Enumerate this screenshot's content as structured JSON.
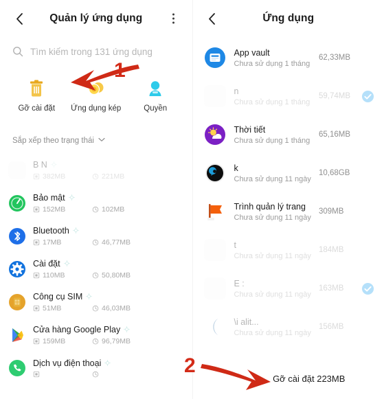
{
  "left_screen": {
    "header": {
      "back_icon": "chevron-left-icon",
      "title": "Quản lý ứng dụng",
      "overflow_icon": "kebab-menu-icon"
    },
    "search": {
      "icon": "search-icon",
      "placeholder": "Tìm kiếm trong 131 ứng dụng",
      "value": ""
    },
    "quick_actions": [
      {
        "label": "Gỡ cài đặt",
        "icon": "trash-icon",
        "color": "#F0B429"
      },
      {
        "label": "Ứng dụng kép",
        "icon": "coins-icon",
        "color": "#FFC83D"
      },
      {
        "label": "Quyền",
        "icon": "person-icon",
        "color": "#22BDE0"
      }
    ],
    "sort": {
      "label": "Sắp xếp theo trạng thái",
      "caret_icon": "chevron-down-icon"
    },
    "apps": [
      {
        "name": "B        N",
        "app_size": "382MB",
        "data_size": "221MB",
        "icon": "blank-icon",
        "icon_color": "#ffffff",
        "faded": true
      },
      {
        "name": "Bảo mật",
        "app_size": "152MB",
        "data_size": "102MB",
        "icon": "shield-security-icon",
        "icon_color": "#22C55E",
        "faded": false
      },
      {
        "name": "Bluetooth",
        "app_size": "17MB",
        "data_size": "46,77MB",
        "icon": "bluetooth-icon",
        "icon_color": "#1E6FE8",
        "faded": false
      },
      {
        "name": "Cài đặt",
        "app_size": "110MB",
        "data_size": "50,80MB",
        "icon": "gear-settings-icon",
        "icon_color": "#1273DE",
        "faded": false
      },
      {
        "name": "Công cụ SIM",
        "app_size": "51MB",
        "data_size": "46,03MB",
        "icon": "sim-card-icon",
        "icon_color": "#E5A32B",
        "faded": false
      },
      {
        "name": "Cửa hàng Google Play",
        "app_size": "159MB",
        "data_size": "96,79MB",
        "icon": "google-play-icon",
        "icon_color": "#34A853",
        "faded": false
      },
      {
        "name": "Dịch vụ điện thoại",
        "app_size": "",
        "data_size": "",
        "icon": "phone-icon",
        "icon_color": "#2ECC71",
        "faded": false
      }
    ],
    "storage_icon": "storage-icon",
    "clock_icon": "clock-icon"
  },
  "right_screen": {
    "header": {
      "back_icon": "chevron-left-icon",
      "title": "Ứng dụng"
    },
    "apps": [
      {
        "name": "App vault",
        "status": "Chưa sử dụng 1 tháng",
        "size": "62,33MB",
        "checked": false,
        "icon": "app-vault-icon",
        "icon_color": "#1E88E5",
        "faded": false
      },
      {
        "name": "n",
        "status": "Chưa sử dụng 1 tháng",
        "size": "59,74MB",
        "checked": true,
        "icon": "blank-icon",
        "icon_color": "#ffffff",
        "faded": true
      },
      {
        "name": "Thời tiết",
        "status": "Chưa sử dụng 1 tháng",
        "size": "65,16MB",
        "checked": false,
        "icon": "weather-icon",
        "icon_color": "#7B20C4",
        "faded": false
      },
      {
        "name": "k",
        "status": "Chưa sử dụng 11 ngày",
        "size": "10,68GB",
        "checked": false,
        "icon": "dark-circle-icon",
        "icon_color": "#111111",
        "faded": false
      },
      {
        "name": "Trình quản lý trang",
        "status": "Chưa sử dụng 11 ngày",
        "size": "309MB",
        "checked": false,
        "icon": "flag-icon",
        "icon_color": "#F4600C",
        "faded": false
      },
      {
        "name": "t",
        "status": "Chưa sử dụng 11 ngày",
        "size": "184MB",
        "checked": false,
        "icon": "blank-icon",
        "icon_color": "#ffffff",
        "faded": true
      },
      {
        "name": "E     :",
        "status": "Chưa sử dụng 11 ngày",
        "size": "163MB",
        "checked": true,
        "icon": "blank-icon",
        "icon_color": "#ffffff",
        "faded": true
      },
      {
        "name": "\\i                     alit...",
        "status": "Chưa sử dụng 11 ngày",
        "size": "156MB",
        "checked": false,
        "icon": "blue-partial-icon",
        "icon_color": "#2E6DA4",
        "faded": true
      }
    ],
    "uninstall_button": "Gỡ cài đặt 223MB",
    "check_icon": "check-circle-icon",
    "check_color": "#1CA0F0"
  },
  "annotations": {
    "arrow_color": "#CF2A16",
    "marker_1": "1",
    "marker_2": "2"
  }
}
